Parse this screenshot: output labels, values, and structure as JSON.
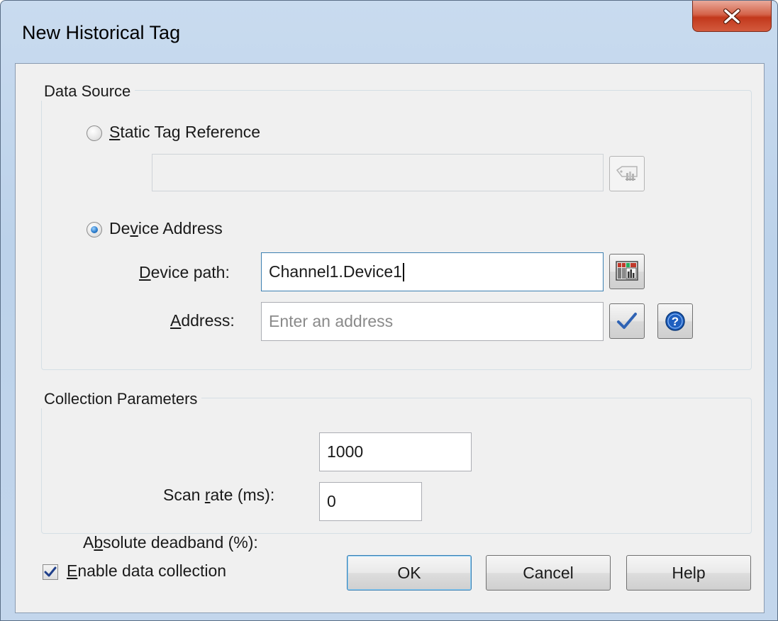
{
  "window": {
    "title": "New Historical Tag"
  },
  "data_source": {
    "group_label": "Data Source",
    "static_tag_reference": {
      "label_accel": "S",
      "label_rest": "tatic Tag Reference",
      "selected": false,
      "value": ""
    },
    "device_address": {
      "label_pre": "De",
      "label_accel": "v",
      "label_rest": "ice Address",
      "selected": true
    },
    "device_path": {
      "label_accel": "D",
      "label_rest": "evice path:",
      "value": "Channel1.Device1"
    },
    "address": {
      "label_accel": "A",
      "label_rest": "ddress:",
      "placeholder": "Enter an address"
    }
  },
  "collection_parameters": {
    "group_label": "Collection Parameters",
    "scan_rate": {
      "label_pre": "Scan ",
      "label_accel": "r",
      "label_rest": "ate (ms):",
      "value": "1000"
    },
    "absolute_deadband": {
      "label_pre": "A",
      "label_accel": "b",
      "label_rest": "solute deadband (%):",
      "value": "0"
    }
  },
  "footer": {
    "enable_collection": {
      "label_accel": "E",
      "label_rest": "nable data collection",
      "checked": true
    },
    "ok_label": "OK",
    "cancel_label": "Cancel",
    "help_label": "Help"
  },
  "icons": {
    "close": "close-icon",
    "tag_browse": "tag-browse-icon",
    "device_browse": "device-browse-icon",
    "validate": "checkmark-icon",
    "help": "help-icon"
  },
  "colors": {
    "close_button": "#c94a2f",
    "accent_blue": "#3c7fb1",
    "window_frame": "#c3d6ec"
  }
}
